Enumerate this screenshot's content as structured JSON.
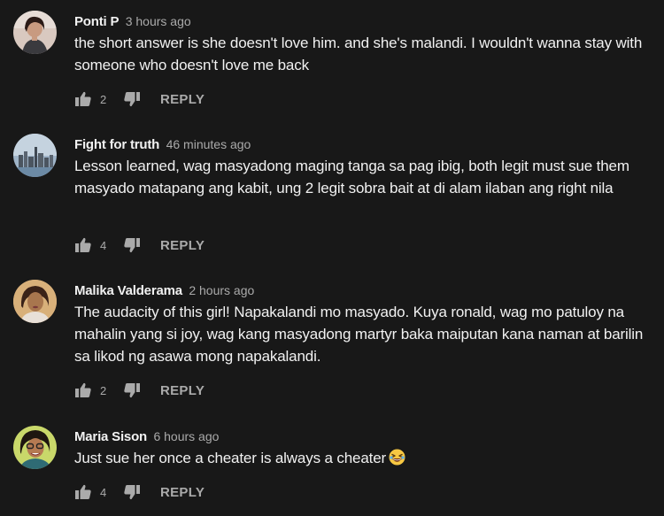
{
  "comments": [
    {
      "author": "Ponti P",
      "time": "3 hours ago",
      "text": "the short answer is she doesn't love him. and she's malandi. I wouldn't wanna stay with someone who doesn't love me back",
      "likes": "2",
      "reply_label": "REPLY"
    },
    {
      "author": "Fight for truth",
      "time": "46 minutes ago",
      "text": "Lesson learned, wag masyadong maging tanga sa pag ibig,  both legit must sue them masyado matapang ang kabit, ung 2 legit sobra bait at di alam ilaban ang right nila",
      "likes": "4",
      "reply_label": "REPLY"
    },
    {
      "author": "Malika Valderama",
      "time": "2 hours ago",
      "text": "The audacity of this girl!  Napakalandi mo masyado. Kuya ronald,  wag mo patuloy na mahalin yang si joy, wag kang masyadong martyr baka maiputan kana naman at barilin sa likod ng asawa mong napakalandi.",
      "likes": "2",
      "reply_label": "REPLY"
    },
    {
      "author": "Maria Sison",
      "time": "6 hours ago",
      "text": "Just sue her once a cheater is always a cheater",
      "emoji": "grinning-squinting-face-icon",
      "likes": "4",
      "reply_label": "REPLY"
    }
  ]
}
